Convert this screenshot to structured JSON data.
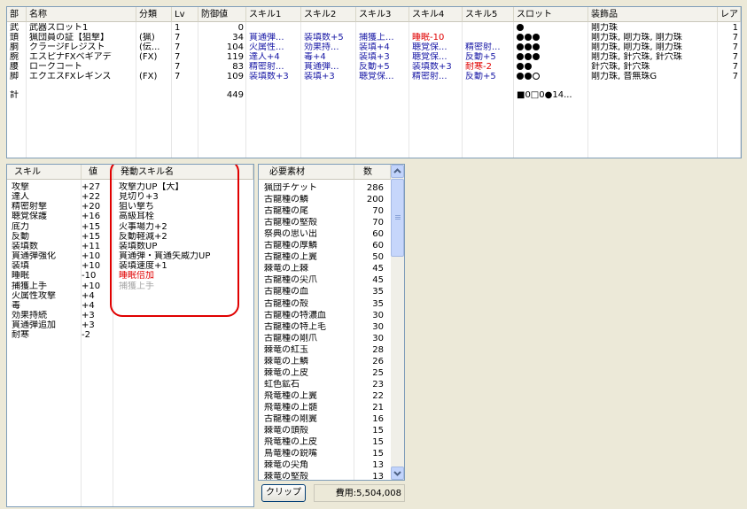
{
  "equipment": {
    "headers": [
      "部",
      "名称",
      "分類",
      "Lv",
      "防御値",
      "スキル1",
      "スキル2",
      "スキル3",
      "スキル4",
      "スキル5",
      "スロット",
      "装飾品",
      "レア"
    ],
    "rows": [
      {
        "part": "武",
        "name": "武器スロット1",
        "cls": "",
        "lv": "1",
        "def": "0",
        "s1": "",
        "s2": "",
        "s3": "",
        "s4": "",
        "s5": "",
        "slots": [
          1
        ],
        "deco": "剛力珠",
        "rare": "1"
      },
      {
        "part": "頭",
        "name": "猟団員の証【狙撃】",
        "cls": "(猟)",
        "lv": "7",
        "def": "34",
        "s1": "貫通弾...",
        "s2": "装填数+5",
        "s3": "捕獲上...",
        "s4": "睡眠-10",
        "s5": "",
        "slots": [
          1,
          1,
          1
        ],
        "deco": "剛力珠, 剛力珠, 剛力珠",
        "rare": "7"
      },
      {
        "part": "胴",
        "name": "クラージFレジスト",
        "cls": "(伝...",
        "lv": "7",
        "def": "104",
        "s1": "火属性...",
        "s2": "効果持...",
        "s3": "装填+4",
        "s4": "聴覚保...",
        "s5": "精密射...",
        "slots": [
          1,
          1,
          1
        ],
        "deco": "剛力珠, 剛力珠, 剛力珠",
        "rare": "7"
      },
      {
        "part": "腕",
        "name": "エスピナFXベギアデ",
        "cls": "(FX)",
        "lv": "7",
        "def": "119",
        "s1": "達人+4",
        "s2": "毒+4",
        "s3": "装填+3",
        "s4": "聴覚保...",
        "s5": "反動+5",
        "slots": [
          1,
          1,
          1
        ],
        "deco": "剛力珠, 針穴珠, 針穴珠",
        "rare": "7"
      },
      {
        "part": "腰",
        "name": "ロークコート",
        "cls": "",
        "lv": "7",
        "def": "83",
        "s1": "精密射...",
        "s2": "貫通弾...",
        "s3": "反動+5",
        "s4": "装填数+3",
        "s5": "耐寒-2",
        "slots": [
          1,
          1
        ],
        "deco": "針穴珠, 針穴珠",
        "rare": "7"
      },
      {
        "part": "脚",
        "name": "エクエスFXレギンス",
        "cls": "(FX)",
        "lv": "7",
        "def": "109",
        "s1": "装填数+3",
        "s2": "装填+3",
        "s3": "聴覚保...",
        "s4": "精密射...",
        "s5": "反動+5",
        "slots": [
          1,
          1,
          0
        ],
        "deco": "剛力珠, 音無珠G",
        "rare": "7"
      }
    ],
    "total": {
      "label": "計",
      "def": "449",
      "slots": "■0□0●14..."
    }
  },
  "skills": {
    "headers": [
      "スキル",
      "値"
    ],
    "rows": [
      {
        "name": "攻撃",
        "value": "+27"
      },
      {
        "name": "達人",
        "value": "+22"
      },
      {
        "name": "精密射撃",
        "value": "+20"
      },
      {
        "name": "聴覚保護",
        "value": "+16"
      },
      {
        "name": "底力",
        "value": "+15"
      },
      {
        "name": "反動",
        "value": "+15"
      },
      {
        "name": "装填数",
        "value": "+11"
      },
      {
        "name": "貫通弾強化",
        "value": "+10"
      },
      {
        "name": "装填",
        "value": "+10"
      },
      {
        "name": "睡眠",
        "value": "-10"
      },
      {
        "name": "捕獲上手",
        "value": "+10"
      },
      {
        "name": "火属性攻撃",
        "value": "+4"
      },
      {
        "name": "毒",
        "value": "+4"
      },
      {
        "name": "効果持続",
        "value": "+3"
      },
      {
        "name": "貫通弾追加",
        "value": "+3"
      },
      {
        "name": "耐寒",
        "value": "-2"
      }
    ]
  },
  "activated": {
    "header": "発動スキル名",
    "rows": [
      {
        "name": "攻撃力UP【大】",
        "style": "normal"
      },
      {
        "name": "見切り+3",
        "style": "normal"
      },
      {
        "name": "狙い撃ち",
        "style": "normal"
      },
      {
        "name": "高級耳栓",
        "style": "normal"
      },
      {
        "name": "火事場力+2",
        "style": "normal"
      },
      {
        "name": "反動軽減+2",
        "style": "normal"
      },
      {
        "name": "装填数UP",
        "style": "normal"
      },
      {
        "name": "貫通弾・貫通矢威力UP",
        "style": "normal"
      },
      {
        "name": "装填速度+1",
        "style": "normal"
      },
      {
        "name": "睡眠倍加",
        "style": "red"
      },
      {
        "name": "捕獲上手",
        "style": "gray"
      }
    ]
  },
  "materials": {
    "headers": [
      "必要素材",
      "数"
    ],
    "rows": [
      {
        "name": "猟団チケット",
        "qty": "286"
      },
      {
        "name": "古龍種の鱗",
        "qty": "200"
      },
      {
        "name": "古龍種の尾",
        "qty": "70"
      },
      {
        "name": "古龍種の堅殻",
        "qty": "70"
      },
      {
        "name": "祭典の思い出",
        "qty": "60"
      },
      {
        "name": "古龍種の厚鱗",
        "qty": "60"
      },
      {
        "name": "古龍種の上翼",
        "qty": "50"
      },
      {
        "name": "棘竜の上棘",
        "qty": "45"
      },
      {
        "name": "古龍種の尖爪",
        "qty": "45"
      },
      {
        "name": "古龍種の血",
        "qty": "35"
      },
      {
        "name": "古龍種の殻",
        "qty": "35"
      },
      {
        "name": "古龍種の特濃血",
        "qty": "30"
      },
      {
        "name": "古龍種の特上毛",
        "qty": "30"
      },
      {
        "name": "古龍種の剛爪",
        "qty": "30"
      },
      {
        "name": "棘竜の紅玉",
        "qty": "28"
      },
      {
        "name": "棘竜の上鱗",
        "qty": "26"
      },
      {
        "name": "棘竜の上皮",
        "qty": "25"
      },
      {
        "name": "虹色鉱石",
        "qty": "23"
      },
      {
        "name": "飛竜種の上翼",
        "qty": "22"
      },
      {
        "name": "飛竜種の上髄",
        "qty": "21"
      },
      {
        "name": "古龍種の剛翼",
        "qty": "16"
      },
      {
        "name": "棘竜の頭殻",
        "qty": "15"
      },
      {
        "name": "飛竜種の上皮",
        "qty": "15"
      },
      {
        "name": "鳥竜種の鋭嘴",
        "qty": "15"
      },
      {
        "name": "棘竜の尖角",
        "qty": "13"
      },
      {
        "name": "棘竜の堅殻",
        "qty": "13"
      }
    ]
  },
  "footer": {
    "clip_label": "クリップ",
    "cost": "費用:5,504,008"
  },
  "colors": {
    "skill_blue": "#1a1aa6",
    "negative_red": "#e00000",
    "annotation_red": "#e00000",
    "disabled_gray": "#a6a6a6"
  },
  "icons": {
    "filled_slot": "filled-slot-icon",
    "empty_slot": "empty-slot-icon",
    "scroll_up": "scroll-up-icon",
    "scroll_down": "scroll-down-icon"
  }
}
